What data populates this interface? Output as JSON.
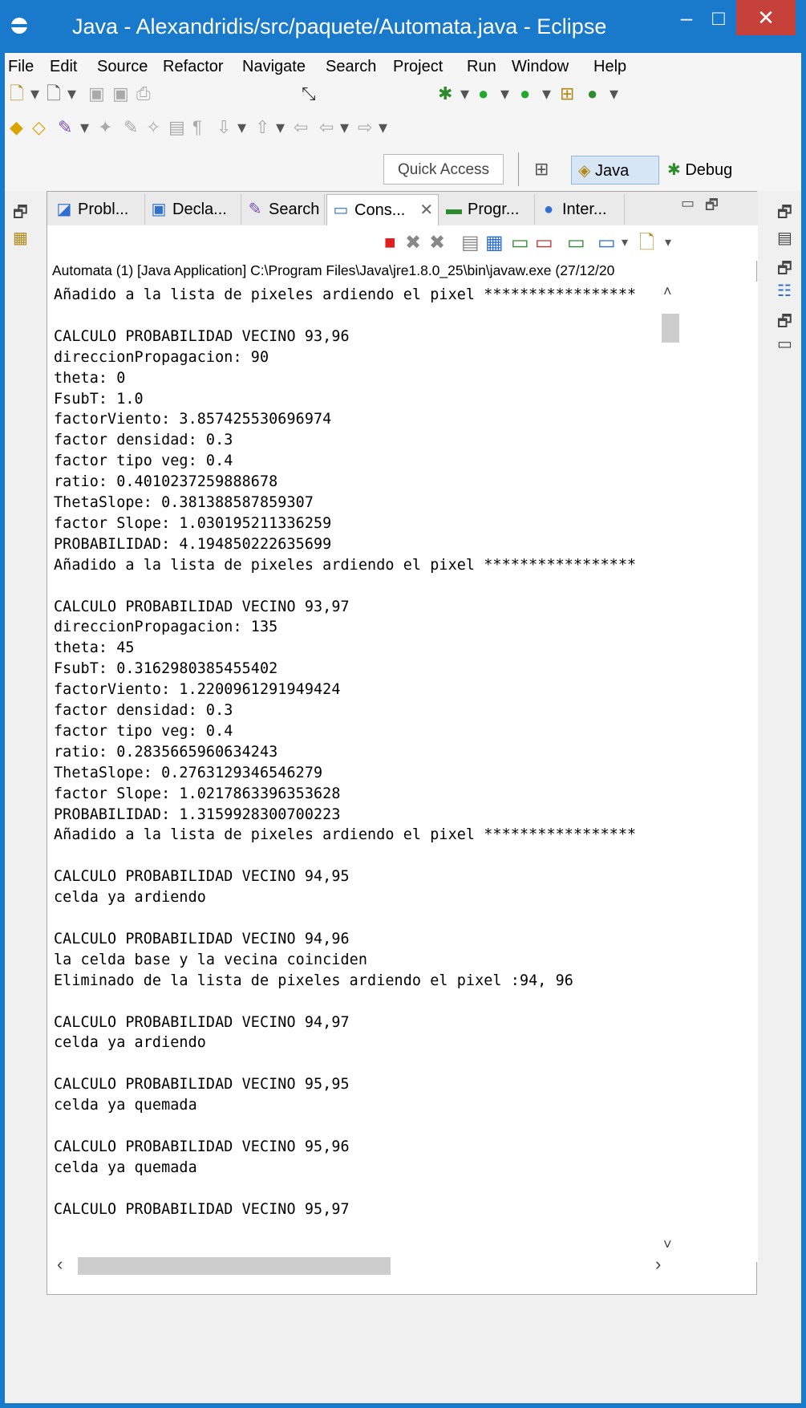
{
  "window": {
    "title": "Java - Alexandridis/src/paquete/Automata.java - Eclipse",
    "min": "–",
    "max": "□",
    "close": "✕"
  },
  "menu": [
    "File",
    "Edit",
    "Source",
    "Refactor",
    "Navigate",
    "Search",
    "Project",
    "Run",
    "Window",
    "Help"
  ],
  "toolbar": {
    "quick_access": "Quick Access",
    "java": "Java",
    "debug": "Debug"
  },
  "tabs": [
    {
      "label": "Probl...",
      "icon": "problems-icon"
    },
    {
      "label": "Decla...",
      "icon": "declaration-icon"
    },
    {
      "label": "Search",
      "icon": "search-icon"
    },
    {
      "label": "Cons...",
      "icon": "console-icon",
      "active": true
    },
    {
      "label": "Progr...",
      "icon": "progress-icon"
    },
    {
      "label": "Inter...",
      "icon": "internal-web-icon"
    }
  ],
  "console": {
    "process": "Automata (1) [Java Application] C:\\Program Files\\Java\\jre1.8.0_25\\bin\\javaw.exe (27/12/20",
    "lines": [
      "Añadido a la lista de pixeles ardiendo el pixel *****************",
      "",
      "CALCULO PROBABILIDAD VECINO 93,96",
      "direccionPropagacion: 90",
      "theta: 0",
      "FsubT: 1.0",
      "factorViento: 3.857425530696974",
      "factor densidad: 0.3",
      "factor tipo veg: 0.4",
      "ratio: 0.4010237259888678",
      "ThetaSlope: 0.381388587859307",
      "factor Slope: 1.030195211336259",
      "PROBABILIDAD: 4.194850222635699",
      "Añadido a la lista de pixeles ardiendo el pixel *****************",
      "",
      "CALCULO PROBABILIDAD VECINO 93,97",
      "direccionPropagacion: 135",
      "theta: 45",
      "FsubT: 0.3162980385455402",
      "factorViento: 1.2200961291949424",
      "factor densidad: 0.3",
      "factor tipo veg: 0.4",
      "ratio: 0.2835665960634243",
      "ThetaSlope: 0.2763129346546279",
      "factor Slope: 1.0217863396353628",
      "PROBABILIDAD: 1.3159928300700223",
      "Añadido a la lista de pixeles ardiendo el pixel *****************",
      "",
      "CALCULO PROBABILIDAD VECINO 94,95",
      "celda ya ardiendo",
      "",
      "CALCULO PROBABILIDAD VECINO 94,96",
      "la celda base y la vecina coinciden",
      "Eliminado de la lista de pixeles ardiendo el pixel :94, 96",
      "",
      "CALCULO PROBABILIDAD VECINO 94,97",
      "celda ya ardiendo",
      "",
      "CALCULO PROBABILIDAD VECINO 95,95",
      "celda ya quemada",
      "",
      "CALCULO PROBABILIDAD VECINO 95,96",
      "celda ya quemada",
      "",
      "CALCULO PROBABILIDAD VECINO 95,97"
    ]
  }
}
